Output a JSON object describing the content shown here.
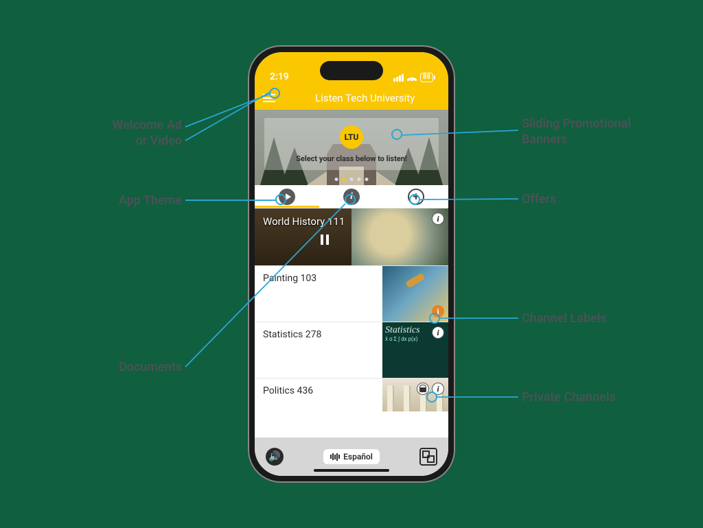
{
  "annotations": {
    "welcome": "Welcome Ad\nor Video",
    "app_theme": "App Theme",
    "documents": "Documents",
    "sliding_banners": "Sliding Promotional\nBanners",
    "offers": "Offers",
    "channel_labels": "Channel Labels",
    "private_channels": "Private Channels"
  },
  "status_bar": {
    "time": "2:19",
    "battery": "88"
  },
  "app": {
    "title": "Listen Tech University",
    "banner": {
      "badge": "LTU",
      "tagline": "Select your class below to listen!"
    },
    "tabs": {
      "play_label": "play",
      "info_label": "i",
      "plus_label": "+"
    },
    "channels": [
      {
        "name": "World History 111"
      },
      {
        "name": "Painting 103"
      },
      {
        "name": "Statistics 278"
      },
      {
        "name": "Politics 436"
      }
    ],
    "language_button": "Español"
  }
}
